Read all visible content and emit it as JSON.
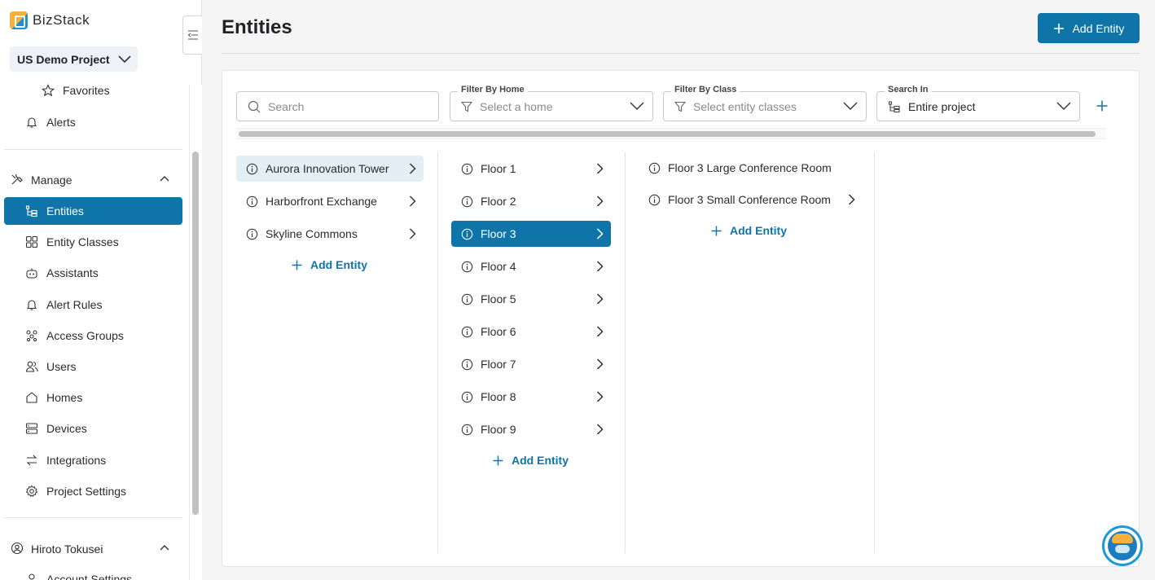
{
  "app": {
    "name": "BizStack"
  },
  "project": {
    "name": "US Demo Project"
  },
  "sidebar": {
    "top_items": [
      {
        "label": "Favorites",
        "icon": "star-icon"
      },
      {
        "label": "Alerts",
        "icon": "bell-icon"
      }
    ],
    "manage": {
      "title": "Manage",
      "items": [
        {
          "label": "Entities",
          "icon": "hierarchy-icon",
          "active": true
        },
        {
          "label": "Entity Classes",
          "icon": "grid-icon"
        },
        {
          "label": "Assistants",
          "icon": "robot-icon"
        },
        {
          "label": "Alert Rules",
          "icon": "bell-icon"
        },
        {
          "label": "Access Groups",
          "icon": "group-icon"
        },
        {
          "label": "Users",
          "icon": "users-icon"
        },
        {
          "label": "Homes",
          "icon": "home-icon"
        },
        {
          "label": "Devices",
          "icon": "device-icon"
        },
        {
          "label": "Integrations",
          "icon": "integrations-icon"
        },
        {
          "label": "Project Settings",
          "icon": "gear-icon"
        }
      ]
    },
    "user": {
      "name": "Hiroto Tokusei",
      "items": [
        {
          "label": "Account Settings",
          "icon": "person-icon"
        }
      ]
    }
  },
  "page": {
    "title": "Entities",
    "add_button": "Add Entity"
  },
  "filters": {
    "search": {
      "placeholder": "Search"
    },
    "home": {
      "label": "Filter By Home",
      "placeholder": "Select a home"
    },
    "class": {
      "label": "Filter By Class",
      "placeholder": "Select entity classes"
    },
    "search_in": {
      "label": "Search In",
      "value": "Entire project"
    }
  },
  "columns": [
    {
      "items": [
        {
          "label": "Aurora Innovation Tower",
          "selected": true
        },
        {
          "label": "Harborfront Exchange"
        },
        {
          "label": "Skyline Commons"
        }
      ],
      "add_label": "Add Entity"
    },
    {
      "items": [
        {
          "label": "Floor 1"
        },
        {
          "label": "Floor 2"
        },
        {
          "label": "Floor 3",
          "active": true
        },
        {
          "label": "Floor 4"
        },
        {
          "label": "Floor 5"
        },
        {
          "label": "Floor 6"
        },
        {
          "label": "Floor 7"
        },
        {
          "label": "Floor 8"
        },
        {
          "label": "Floor 9"
        }
      ],
      "add_label": "Add Entity"
    },
    {
      "items": [
        {
          "label": "Floor 3 Large Conference Room",
          "has_children": false
        },
        {
          "label": "Floor 3 Small Conference Room",
          "has_children": true
        }
      ],
      "add_label": "Add Entity"
    }
  ],
  "colors": {
    "accent": "#0f75a8",
    "selected_bg": "#e3eef5",
    "logo_orange": "#f4b23c"
  }
}
